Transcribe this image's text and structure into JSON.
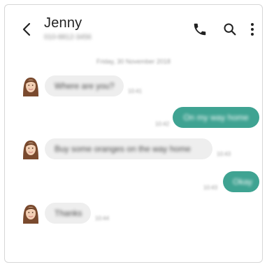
{
  "header": {
    "contact_name": "Jenny",
    "contact_number": "010-8812-3456",
    "icons": [
      "back-icon",
      "phone-icon",
      "search-icon",
      "more-vertical-icon"
    ]
  },
  "conversation": {
    "date": "Friday, 30 November 2018",
    "messages": [
      {
        "direction": "incoming",
        "text": "Where are you?",
        "time": "10:41"
      },
      {
        "direction": "outgoing",
        "text": "On my way home",
        "time": "10:42"
      },
      {
        "direction": "incoming",
        "text": "Buy some oranges on the way home",
        "time": "10:43"
      },
      {
        "direction": "outgoing",
        "text": "Okay",
        "time": "10:43"
      },
      {
        "direction": "incoming",
        "text": "Thanks",
        "time": "10:44"
      }
    ]
  },
  "colors": {
    "incoming_bubble": "#eeeeee",
    "outgoing_bubble": "#3fa392",
    "header_text": "#222222"
  }
}
